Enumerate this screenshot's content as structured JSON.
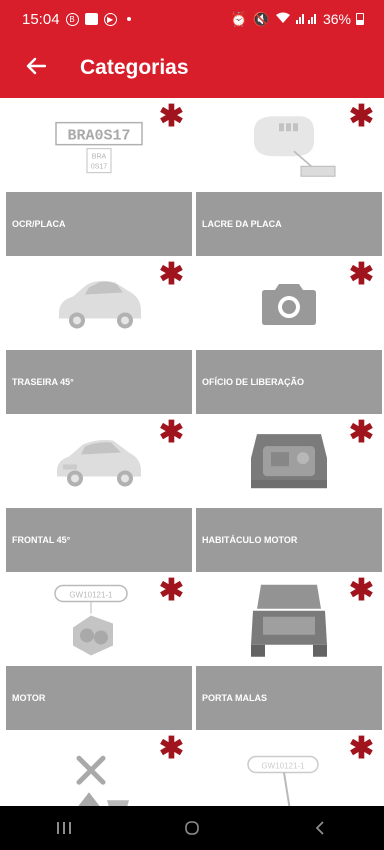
{
  "status_bar": {
    "time": "15:04",
    "battery_text": "36%"
  },
  "app_bar": {
    "title": "Categorias"
  },
  "categories": [
    {
      "label": "OCR/PLACA",
      "icon": "license-plate-icon",
      "plate_top": "BRA0S17",
      "plate_small": "BRA",
      "plate_bottom": "0S17"
    },
    {
      "label": "LACRE DA PLACA",
      "icon": "plate-seal-icon"
    },
    {
      "label": "TRASEIRA 45°",
      "icon": "car-rear-icon"
    },
    {
      "label": "OFÍCIO DE LIBERAÇÃO",
      "icon": "camera-icon"
    },
    {
      "label": "FRONTAL 45°",
      "icon": "car-front-icon"
    },
    {
      "label": "HABITÁCULO MOTOR",
      "icon": "engine-bay-icon"
    },
    {
      "label": "MOTOR",
      "icon": "engine-icon",
      "tag_text": "GW10121-1"
    },
    {
      "label": "PORTA MALAS",
      "icon": "trunk-icon"
    },
    {
      "label": "",
      "icon": "tools-icon"
    },
    {
      "label": "",
      "icon": "chassis-tag-icon",
      "tag_text": "GW10121-1"
    }
  ],
  "required_marker": "✱",
  "colors": {
    "primary": "#d81e2b",
    "required": "#a0141e",
    "label_bg": "#9b9b9b"
  }
}
